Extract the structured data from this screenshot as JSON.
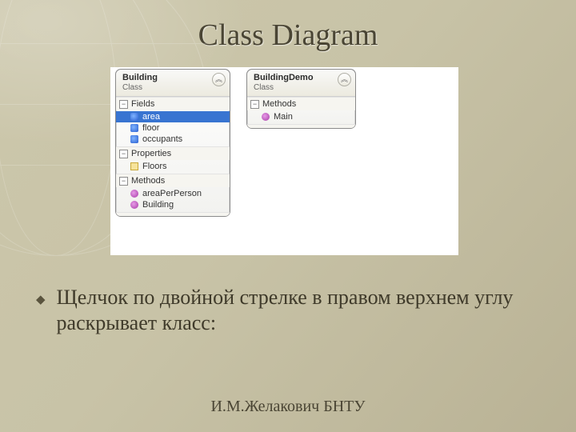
{
  "title": "Class Diagram",
  "diagram": {
    "class1": {
      "name": "Building",
      "kind": "Class",
      "sections": {
        "fields": {
          "label": "Fields",
          "items": [
            "area",
            "floor",
            "occupants"
          ],
          "selected": "area"
        },
        "properties": {
          "label": "Properties",
          "items": [
            "Floors"
          ]
        },
        "methods": {
          "label": "Methods",
          "items": [
            "areaPerPerson",
            "Building"
          ]
        }
      }
    },
    "class2": {
      "name": "BuildingDemo",
      "kind": "Class",
      "sections": {
        "methods": {
          "label": "Methods",
          "items": [
            "Main"
          ]
        }
      }
    }
  },
  "bullet": "Щелчок по двойной стрелке в правом верхнем углу раскрывает класс:",
  "footer": "И.М.Желакович БНТУ"
}
